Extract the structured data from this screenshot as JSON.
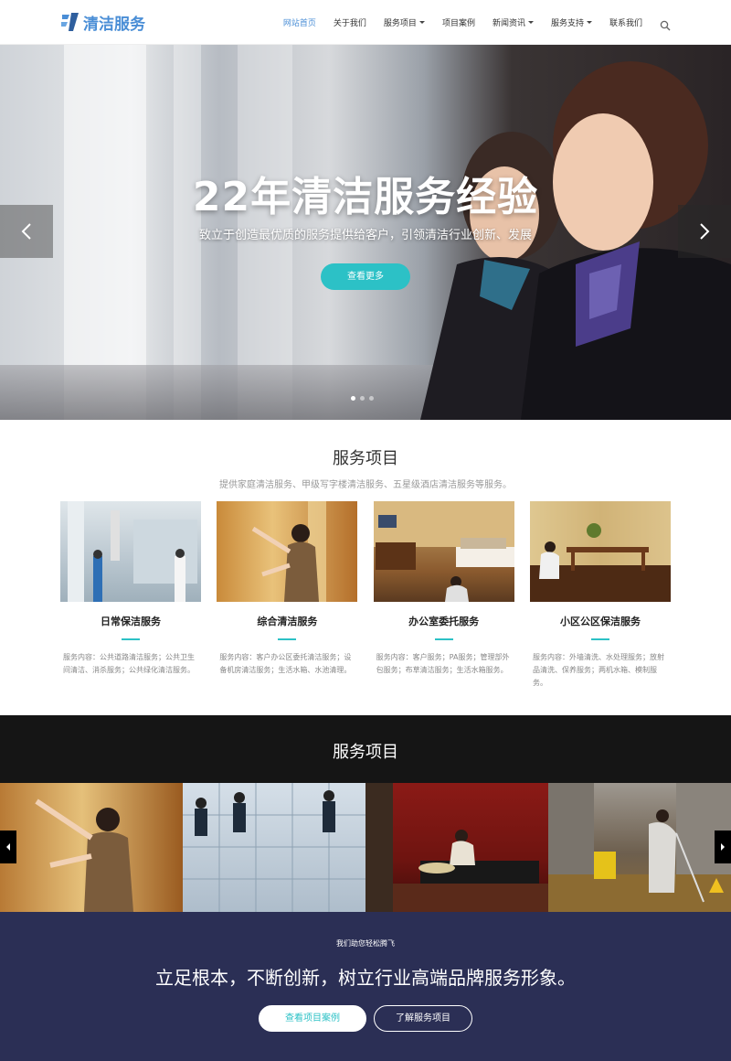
{
  "header": {
    "logo_text": "清洁服务",
    "nav": [
      {
        "label": "网站首页",
        "active": true,
        "dropdown": false
      },
      {
        "label": "关于我们",
        "active": false,
        "dropdown": false
      },
      {
        "label": "服务项目",
        "active": false,
        "dropdown": true
      },
      {
        "label": "项目案例",
        "active": false,
        "dropdown": false
      },
      {
        "label": "新闻资讯",
        "active": false,
        "dropdown": true
      },
      {
        "label": "服务支持",
        "active": false,
        "dropdown": true
      },
      {
        "label": "联系我们",
        "active": false,
        "dropdown": false
      }
    ]
  },
  "hero": {
    "title": "22年清洁服务经验",
    "subtitle": "致立于创造最优质的服务提供给客户，引领清洁行业创新、发展",
    "button_label": "查看更多"
  },
  "services": {
    "title": "服务项目",
    "subtitle": "提供家庭清洁服务、甲级写字楼清洁服务、五星级酒店清洁服务等服务。",
    "cards": [
      {
        "title": "日常保洁服务",
        "desc": "服务内容：公共道路清洁服务；公共卫生间清洁、消杀服务；公共绿化清洁服务。"
      },
      {
        "title": "综合清洁服务",
        "desc": "服务内容：客户办公区委托清洁服务；设备机房清洁服务；生活水箱、水池清理。"
      },
      {
        "title": "办公室委托服务",
        "desc": "服务内容：客户服务；PA服务；管理部外包服务；布草清洁服务；生活水箱服务。"
      },
      {
        "title": "小区公区保洁服务",
        "desc": "服务内容：外墙清洗、水处理服务；放射品清洗、保养服务；两机水箱、模制服务。"
      }
    ]
  },
  "gallery": {
    "title": "服务项目"
  },
  "cta": {
    "small": "我们助您轻松腾飞",
    "big": "立足根本，不断创新，树立行业高端品牌服务形象。",
    "btn_primary": "查看项目案例",
    "btn_secondary": "了解服务项目"
  },
  "colors": {
    "accent": "#2cc1c6",
    "brand": "#4a8ed6",
    "cta_bg": "#2b2f55",
    "dark_bg": "#151515"
  }
}
